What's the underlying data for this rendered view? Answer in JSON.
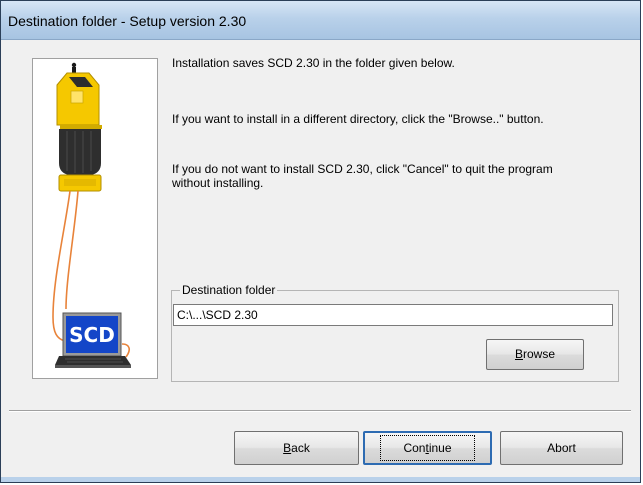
{
  "window": {
    "title": "Destination folder - Setup version 2.30"
  },
  "messages": {
    "line1": "Installation saves SCD 2.30 in the folder given below.",
    "line2": "If you want to install in a different directory, click the \"Browse..\" button.",
    "line3": "If you do not want to install SCD 2.30, click \"Cancel\" to quit the program without installing."
  },
  "illustration": {
    "laptop_screen_text": "SCD"
  },
  "destination": {
    "group_label": "Destination folder",
    "path": "C:\\...\\SCD 2.30",
    "browse_label": "Browse"
  },
  "buttons": {
    "back": "Back",
    "continue": "Continue",
    "abort": "Abort"
  },
  "colors": {
    "sensor_yellow": "#f5c800",
    "sensor_dark": "#2e2e2e",
    "cable_orange": "#e8833a",
    "laptop_screen_blue": "#1446c8"
  }
}
